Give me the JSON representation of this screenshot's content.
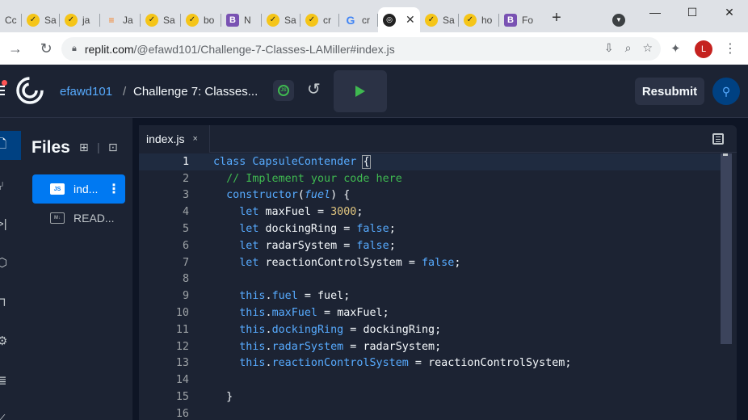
{
  "browser": {
    "tabs": [
      {
        "title": "Cc",
        "icon": "generic-favicon"
      },
      {
        "title": "Sa",
        "icon": "check-favicon"
      },
      {
        "title": "ja",
        "icon": "check-favicon"
      },
      {
        "title": "Ja",
        "icon": "stackoverflow-favicon"
      },
      {
        "title": "Sa",
        "icon": "check-favicon"
      },
      {
        "title": "bo",
        "icon": "check-favicon"
      },
      {
        "title": "N",
        "icon": "bootstrap-favicon"
      },
      {
        "title": "Sa",
        "icon": "check-favicon"
      },
      {
        "title": "cr",
        "icon": "check-favicon"
      },
      {
        "title": "cr",
        "icon": "google-favicon"
      },
      {
        "title": "",
        "icon": "replit-favicon",
        "active": true
      },
      {
        "title": "Sa",
        "icon": "check-favicon"
      },
      {
        "title": "ho",
        "icon": "check-favicon"
      },
      {
        "title": "Fo",
        "icon": "bootstrap-favicon"
      }
    ],
    "close_glyph": "✕",
    "new_tab_glyph": "+",
    "url_host": "replit.com",
    "url_path": "/@efawd101/Challenge-7-Classes-LAMiller#index.js",
    "profile_initial": "L"
  },
  "header": {
    "username": "efawd101",
    "separator": "/",
    "repl_name": "Challenge 7: Classes...",
    "resubmit_label": "Resubmit"
  },
  "files": {
    "title": "Files",
    "items": [
      {
        "name": "ind...",
        "type": "JS",
        "active": true
      },
      {
        "name": "READ...",
        "type": "M↓",
        "active": false
      }
    ]
  },
  "editor": {
    "tab_label": "index.js",
    "tab_close": "×",
    "current_line": 1,
    "lines": [
      {
        "n": "1"
      },
      {
        "n": "2"
      },
      {
        "n": "3"
      },
      {
        "n": "4"
      },
      {
        "n": "5"
      },
      {
        "n": "6"
      },
      {
        "n": "7"
      },
      {
        "n": "8"
      },
      {
        "n": "9"
      },
      {
        "n": "10"
      },
      {
        "n": "11"
      },
      {
        "n": "12"
      },
      {
        "n": "13"
      },
      {
        "n": "14"
      },
      {
        "n": "15"
      },
      {
        "n": "16"
      }
    ],
    "code": {
      "class_kw": "class",
      "class_name": "CapsuleContender",
      "open_brace": "{",
      "comment": "// Implement your code here",
      "ctor": "constructor",
      "param": "fuel",
      "let": "let",
      "maxFuel_decl": "maxFuel",
      "maxFuel_val": "3000",
      "dockingRing_decl": "dockingRing",
      "radarSystem_decl": "radarSystem",
      "rcs_decl": "reactionControlSystem",
      "false_val": "false",
      "this_kw": "this",
      "fuel_prop": "fuel",
      "maxFuel_prop": "maxFuel",
      "dockingRing_prop": "dockingRing",
      "radarSystem_prop": "radarSystem",
      "rcs_prop": "reactionControlSystem",
      "close_brace": "}"
    }
  },
  "colors": {
    "background": "#0e1525",
    "panel": "#1c2333",
    "accent": "#0079f2",
    "run_green": "#3fb950",
    "link_blue": "#57abff"
  }
}
